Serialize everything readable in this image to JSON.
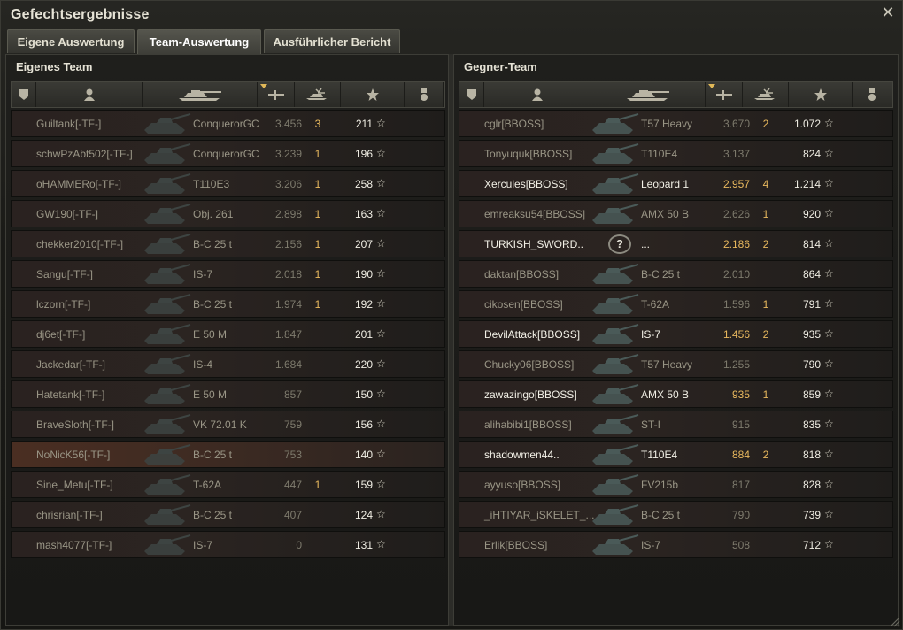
{
  "window": {
    "title": "Gefechtsergebnisse",
    "close_icon": "close-icon"
  },
  "tabs": [
    {
      "label": "Eigene Auswertung",
      "active": false
    },
    {
      "label": "Team-Auswertung",
      "active": true
    },
    {
      "label": "Ausführlicher Bericht",
      "active": false
    }
  ],
  "columns": [
    {
      "icon": "squad-icon"
    },
    {
      "icon": "player-icon"
    },
    {
      "icon": "tank-icon"
    },
    {
      "icon": "damage-icon",
      "sorted": true
    },
    {
      "icon": "kills-icon"
    },
    {
      "icon": "xp-star-icon"
    },
    {
      "icon": "medal-icon"
    }
  ],
  "own_team": {
    "title": "Eigenes Team",
    "players": [
      {
        "name": "Guiltank[-TF-]",
        "vehicle": "ConquerorGC",
        "damage": "3.456",
        "kills": "3",
        "xp": "211"
      },
      {
        "name": "schwPzAbt502[-TF-]",
        "vehicle": "ConquerorGC",
        "damage": "3.239",
        "kills": "1",
        "xp": "196"
      },
      {
        "name": "oHAMMERo[-TF-]",
        "vehicle": "T110E3",
        "damage": "3.206",
        "kills": "1",
        "xp": "258"
      },
      {
        "name": "GW190[-TF-]",
        "vehicle": "Obj. 261",
        "damage": "2.898",
        "kills": "1",
        "xp": "163"
      },
      {
        "name": "chekker2010[-TF-]",
        "vehicle": "B-C 25 t",
        "damage": "2.156",
        "kills": "1",
        "xp": "207"
      },
      {
        "name": "Sangu[-TF-]",
        "vehicle": "IS-7",
        "damage": "2.018",
        "kills": "1",
        "xp": "190"
      },
      {
        "name": "lczorn[-TF-]",
        "vehicle": "B-C 25 t",
        "damage": "1.974",
        "kills": "1",
        "xp": "192"
      },
      {
        "name": "dj6et[-TF-]",
        "vehicle": "E 50 M",
        "damage": "1.847",
        "kills": "",
        "xp": "201"
      },
      {
        "name": "Jackedar[-TF-]",
        "vehicle": "IS-4",
        "damage": "1.684",
        "kills": "",
        "xp": "220"
      },
      {
        "name": "Hatetank[-TF-]",
        "vehicle": "E 50 M",
        "damage": "857",
        "kills": "",
        "xp": "150"
      },
      {
        "name": "BraveSloth[-TF-]",
        "vehicle": "VK 72.01 K",
        "damage": "759",
        "kills": "",
        "xp": "156"
      },
      {
        "name": "NoNicK56[-TF-]",
        "vehicle": "B-C 25 t",
        "damage": "753",
        "kills": "",
        "xp": "140",
        "highlight": true
      },
      {
        "name": "Sine_Metu[-TF-]",
        "vehicle": "T-62A",
        "damage": "447",
        "kills": "1",
        "xp": "159"
      },
      {
        "name": "chrisrian[-TF-]",
        "vehicle": "B-C 25 t",
        "damage": "407",
        "kills": "",
        "xp": "124"
      },
      {
        "name": "mash4077[-TF-]",
        "vehicle": "IS-7",
        "damage": "0",
        "kills": "",
        "xp": "131"
      }
    ]
  },
  "enemy_team": {
    "title": "Gegner-Team",
    "players": [
      {
        "name": "cglr[BBOSS]",
        "vehicle": "T57 Heavy",
        "damage": "3.670",
        "kills": "2",
        "xp": "1.072",
        "alive": false
      },
      {
        "name": "Tonyuquk[BBOSS]",
        "vehicle": "T110E4",
        "damage": "3.137",
        "kills": "",
        "xp": "824",
        "alive": false
      },
      {
        "name": "Xercules[BBOSS]",
        "vehicle": "Leopard 1",
        "damage": "2.957",
        "kills": "4",
        "xp": "1.214",
        "alive": true
      },
      {
        "name": "emreaksu54[BBOSS]",
        "vehicle": "AMX 50 B",
        "damage": "2.626",
        "kills": "1",
        "xp": "920",
        "alive": false
      },
      {
        "name": "TURKISH_SWORD..",
        "vehicle": "...",
        "damage": "2.186",
        "kills": "2",
        "xp": "814",
        "alive": true,
        "unknown": true
      },
      {
        "name": "daktan[BBOSS]",
        "vehicle": "B-C 25 t",
        "damage": "2.010",
        "kills": "",
        "xp": "864",
        "alive": false
      },
      {
        "name": "cikosen[BBOSS]",
        "vehicle": "T-62A",
        "damage": "1.596",
        "kills": "1",
        "xp": "791",
        "alive": false
      },
      {
        "name": "DevilAttack[BBOSS]",
        "vehicle": "IS-7",
        "damage": "1.456",
        "kills": "2",
        "xp": "935",
        "alive": true
      },
      {
        "name": "Chucky06[BBOSS]",
        "vehicle": "T57 Heavy",
        "damage": "1.255",
        "kills": "",
        "xp": "790",
        "alive": false
      },
      {
        "name": "zawazingo[BBOSS]",
        "vehicle": "AMX 50 B",
        "damage": "935",
        "kills": "1",
        "xp": "859",
        "alive": true
      },
      {
        "name": "alihabibi1[BBOSS]",
        "vehicle": "ST-I",
        "damage": "915",
        "kills": "",
        "xp": "835",
        "alive": false
      },
      {
        "name": "shadowmen44..",
        "vehicle": "T110E4",
        "damage": "884",
        "kills": "2",
        "xp": "818",
        "alive": true
      },
      {
        "name": "ayyuso[BBOSS]",
        "vehicle": "FV215b",
        "damage": "817",
        "kills": "",
        "xp": "828",
        "alive": false
      },
      {
        "name": "_iHTIYAR_iSKELET_...",
        "vehicle": "B-C 25 t",
        "damage": "790",
        "kills": "",
        "xp": "739",
        "alive": false
      },
      {
        "name": "Erlik[BBOSS]",
        "vehicle": "IS-7",
        "damage": "508",
        "kills": "",
        "xp": "712",
        "alive": false
      }
    ]
  },
  "unknown_tank_label": "?",
  "star_glyph": "☆"
}
